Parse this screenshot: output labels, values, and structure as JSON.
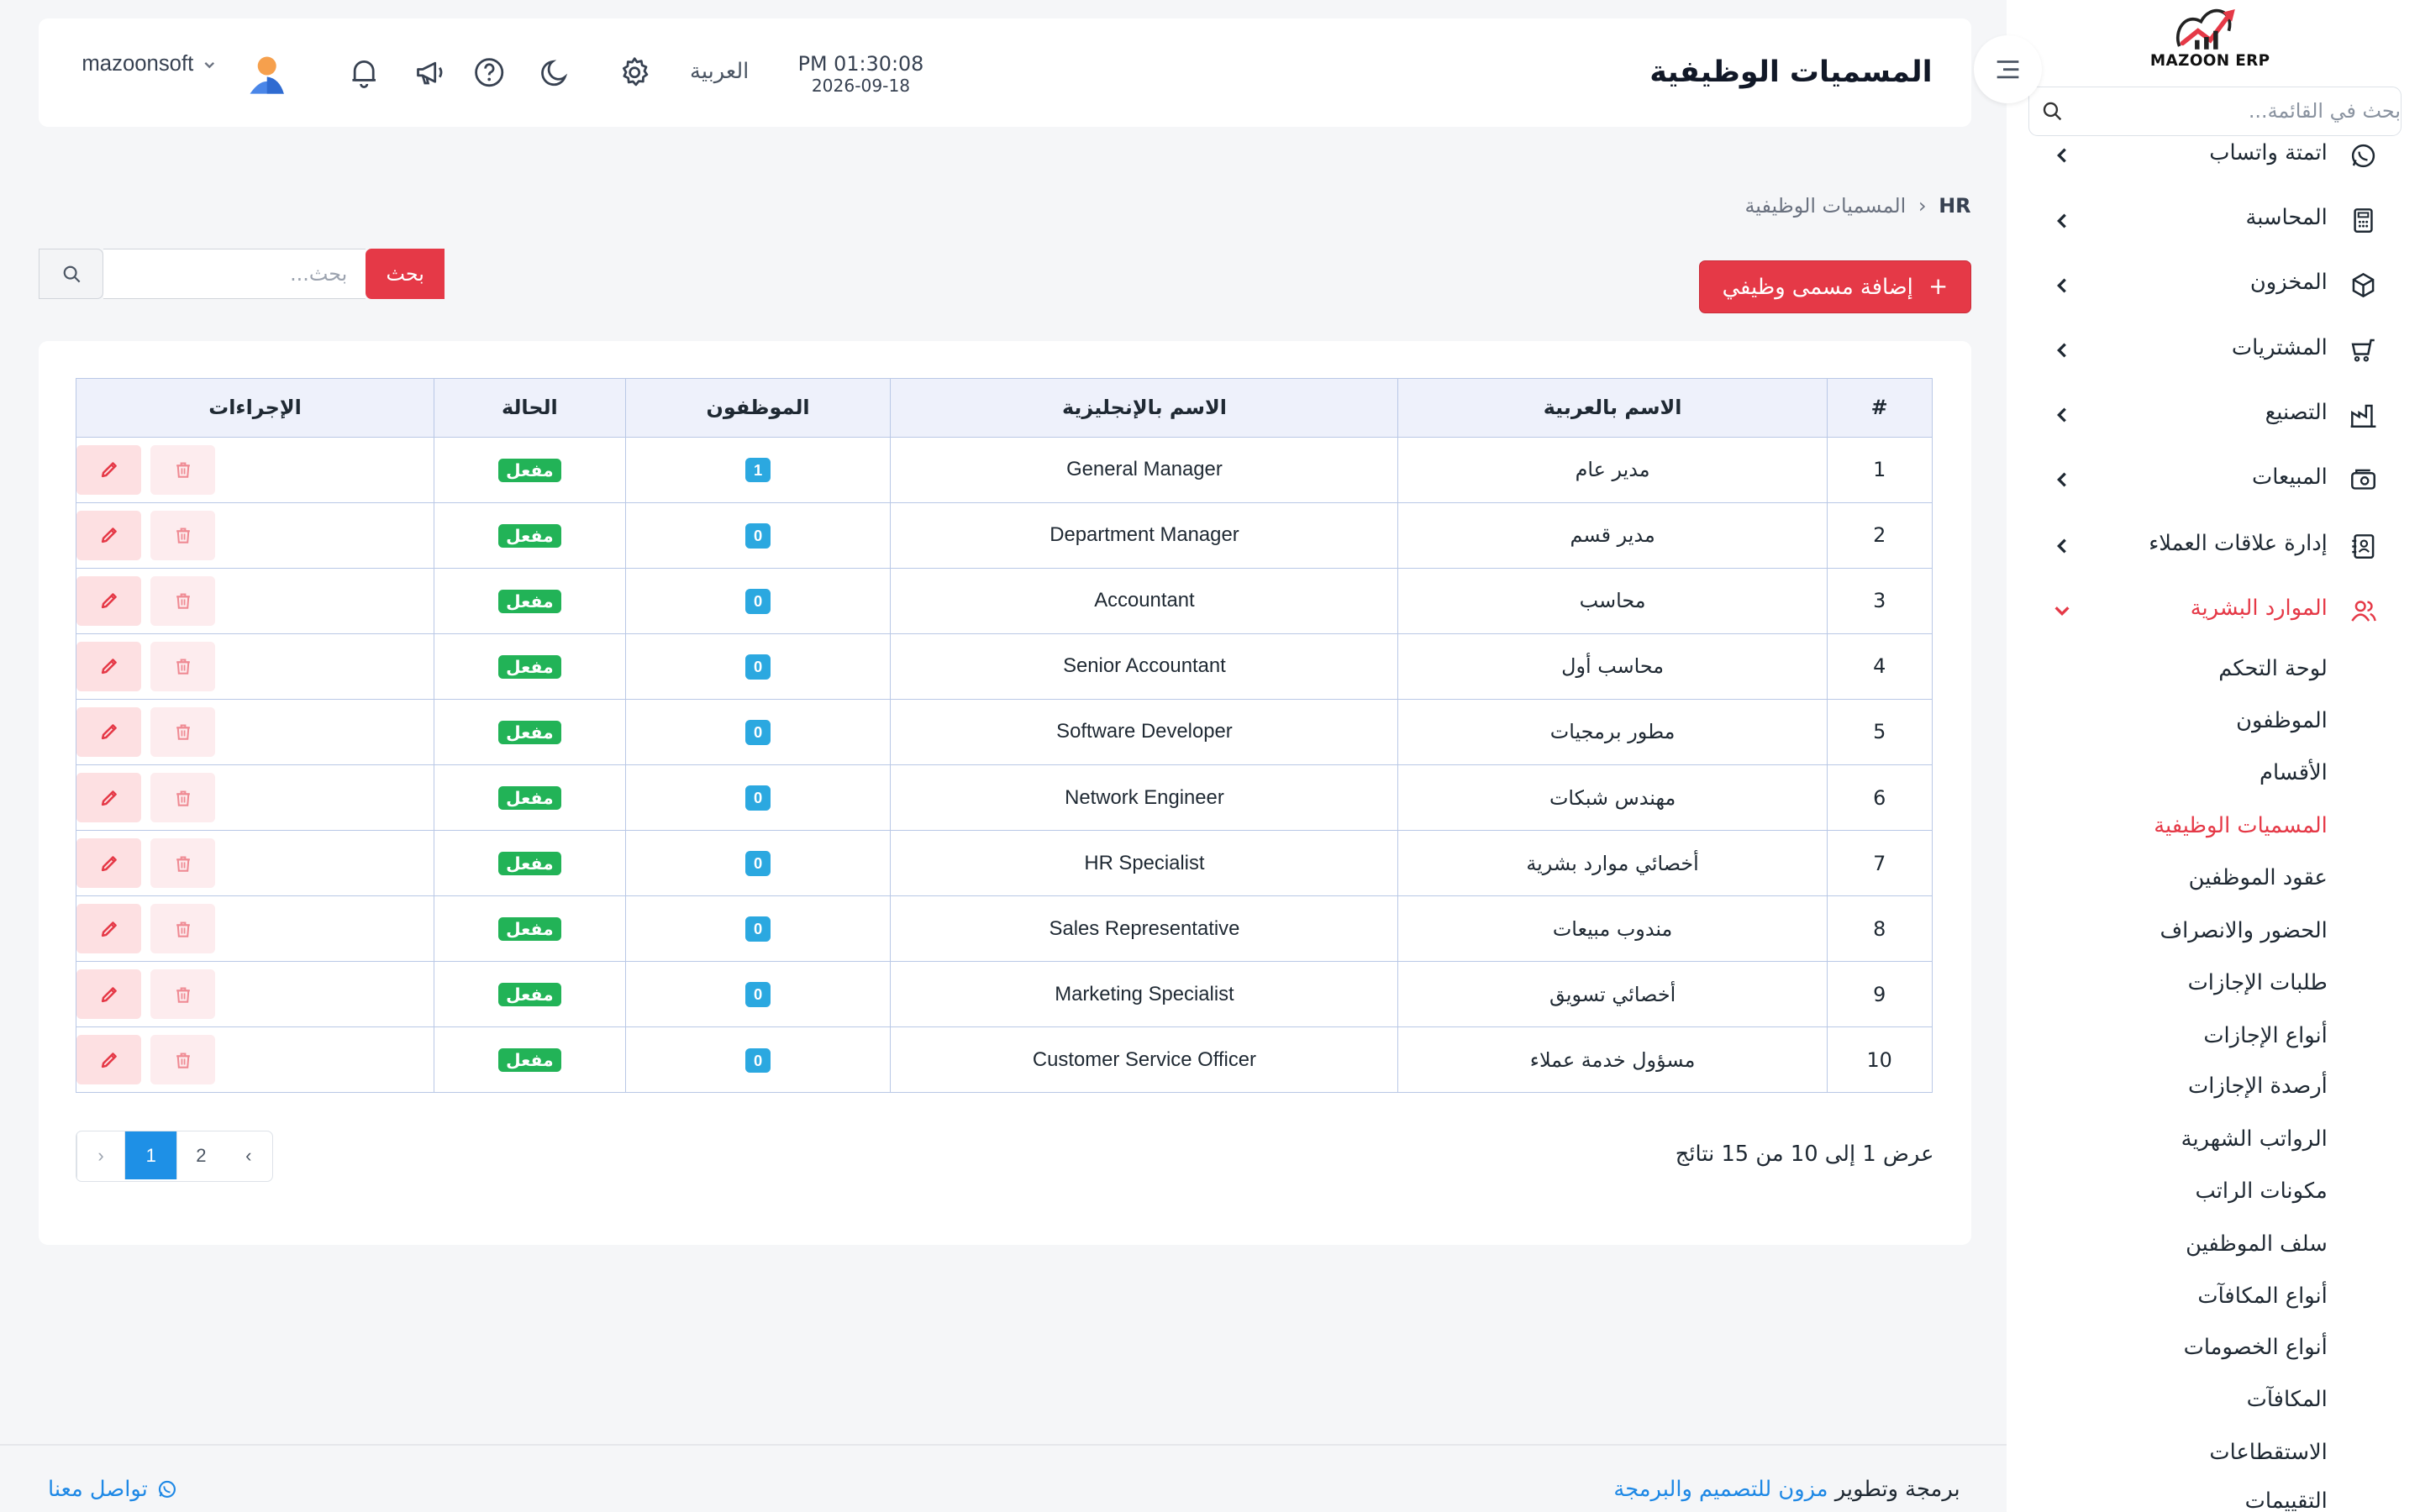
{
  "app": {
    "logo_text": "MAZOON ERP",
    "logo_sub": "ERP|ERP"
  },
  "sidebar": {
    "search_placeholder": "بحث في القائمة...",
    "menu": [
      {
        "label": "اتمتة واتساب",
        "icon": "whatsapp-icon"
      },
      {
        "label": "المحاسبة",
        "icon": "calculator-icon"
      },
      {
        "label": "المخزون",
        "icon": "box-icon"
      },
      {
        "label": "المشتريات",
        "icon": "cart-icon"
      },
      {
        "label": "التصنيع",
        "icon": "factory-icon"
      },
      {
        "label": "المبيعات",
        "icon": "sales-icon"
      },
      {
        "label": "إدارة علاقات العملاء",
        "icon": "contacts-icon"
      },
      {
        "label": "الموارد البشرية",
        "icon": "users-icon",
        "active": true
      }
    ],
    "hr_submenu": [
      "لوحة التحكم",
      "الموظفون",
      "الأقسام",
      "المسميات الوظيفية",
      "عقود الموظفين",
      "الحضور والانصراف",
      "طلبات الإجازات",
      "أنواع الإجازات",
      "أرصدة الإجازات",
      "الرواتب الشهرية",
      "مكونات الراتب",
      "سلف الموظفين",
      "أنواع المكافآت",
      "أنواع الخصومات",
      "المكافآت",
      "الاستقطاعات",
      "التقييمات"
    ],
    "current_submenu": "المسميات الوظيفية"
  },
  "header": {
    "title": "المسميات الوظيفية",
    "time": "PM 01:30:08",
    "date": "2026-09-18",
    "language": "العربية",
    "username": "mazoonsoft"
  },
  "breadcrumb": {
    "root": "HR",
    "current": "المسميات الوظيفية"
  },
  "toolbar": {
    "add_label": "إضافة مسمى وظيفي",
    "search_placeholder": "بحث...",
    "search_button": "بحث"
  },
  "table": {
    "headers": {
      "num": "#",
      "name_ar": "الاسم بالعربية",
      "name_en": "الاسم بالإنجليزية",
      "employees": "الموظفون",
      "status": "الحالة",
      "actions": "الإجراءات"
    },
    "rows": [
      {
        "num": "1",
        "name_ar": "مدير عام",
        "name_en": "General Manager",
        "employees": "1",
        "status": "مفعل"
      },
      {
        "num": "2",
        "name_ar": "مدير قسم",
        "name_en": "Department Manager",
        "employees": "0",
        "status": "مفعل"
      },
      {
        "num": "3",
        "name_ar": "محاسب",
        "name_en": "Accountant",
        "employees": "0",
        "status": "مفعل"
      },
      {
        "num": "4",
        "name_ar": "محاسب أول",
        "name_en": "Senior Accountant",
        "employees": "0",
        "status": "مفعل"
      },
      {
        "num": "5",
        "name_ar": "مطور برمجيات",
        "name_en": "Software Developer",
        "employees": "0",
        "status": "مفعل"
      },
      {
        "num": "6",
        "name_ar": "مهندس شبكات",
        "name_en": "Network Engineer",
        "employees": "0",
        "status": "مفعل"
      },
      {
        "num": "7",
        "name_ar": "أخصائي موارد بشرية",
        "name_en": "HR Specialist",
        "employees": "0",
        "status": "مفعل"
      },
      {
        "num": "8",
        "name_ar": "مندوب مبيعات",
        "name_en": "Sales Representative",
        "employees": "0",
        "status": "مفعل"
      },
      {
        "num": "9",
        "name_ar": "أخصائي تسويق",
        "name_en": "Marketing Specialist",
        "employees": "0",
        "status": "مفعل"
      },
      {
        "num": "10",
        "name_ar": "مسؤول خدمة عملاء",
        "name_en": "Customer Service Officer",
        "employees": "0",
        "status": "مفعل"
      }
    ],
    "summary": "عرض 1 إلى 10 من 15 نتائج"
  },
  "pagination": {
    "prev": "‹",
    "pages": [
      "1",
      "2"
    ],
    "active": "1",
    "next": "›"
  },
  "footer": {
    "contact": "تواصل معنا",
    "credit_prefix": "برمجة وتطوير",
    "credit_link": "مزون للتصميم والبرمجة"
  },
  "colors": {
    "accent": "#e53947",
    "info": "#2ba8e0",
    "success": "#22b357",
    "link": "#1e88e5",
    "page_active": "#1e90e6"
  }
}
